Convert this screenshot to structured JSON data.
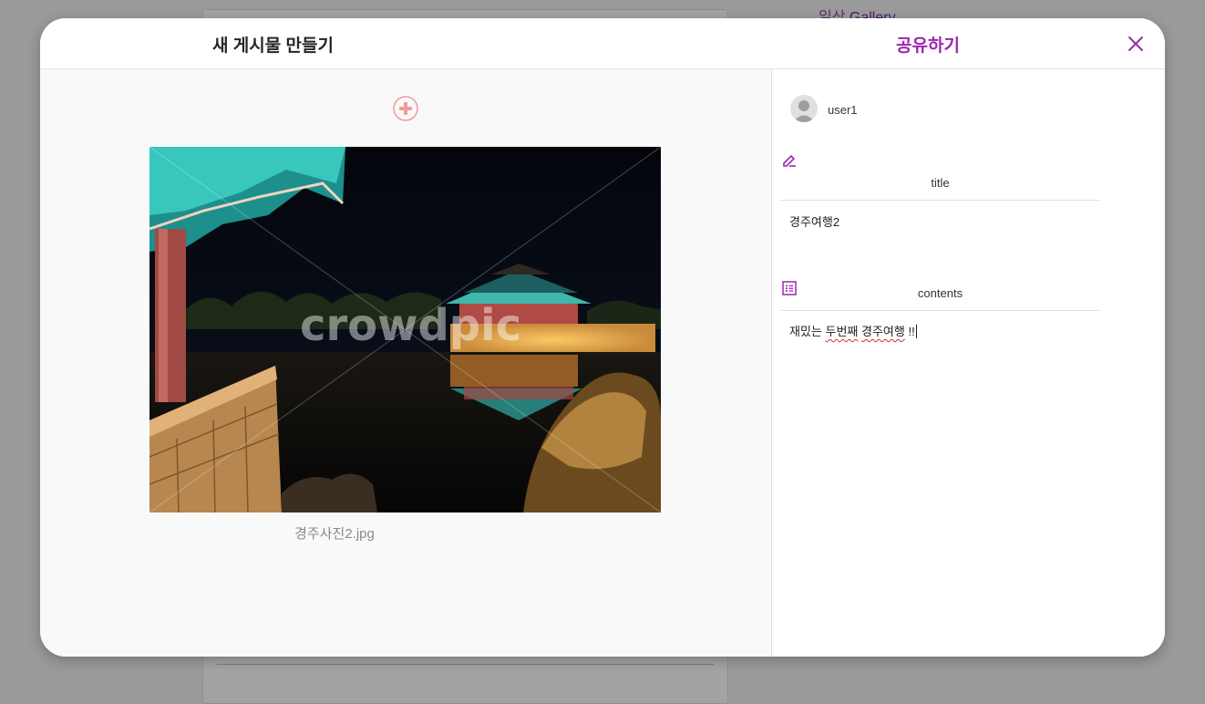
{
  "background": {
    "brand_prefix": "일상",
    "brand_name": "Gallery"
  },
  "modal": {
    "title": "새 게시물 만들기",
    "share_label": "공유하기",
    "close_icon": "close-icon"
  },
  "upload": {
    "add_icon": "add-circle-icon",
    "filename": "경주사진2.jpg",
    "watermark": "crowdpic"
  },
  "post": {
    "username": "user1",
    "title_label": "title",
    "title_value": "경주여행2",
    "contents_label": "contents",
    "contents_part1": "재밌는 ",
    "contents_part2": "두번째",
    "contents_part3": " ",
    "contents_part4": "경주여행",
    "contents_part5": " !!"
  },
  "colors": {
    "accent": "#9c27b0",
    "add_icon": "#ef9a9a",
    "overlay": "#9a9a9a"
  }
}
